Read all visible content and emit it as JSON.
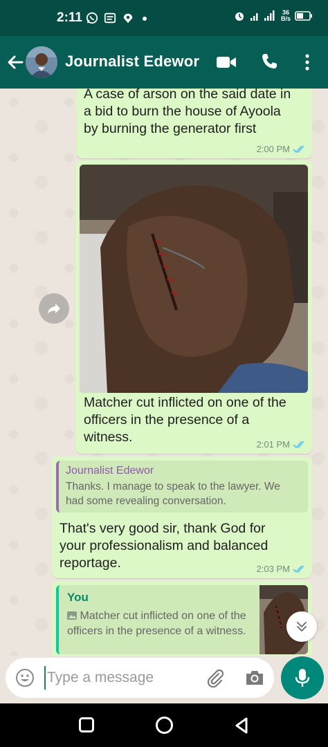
{
  "status_bar": {
    "time": "2:11",
    "network_speed_value": "36",
    "network_speed_unit": "B/s",
    "network_type": "3G"
  },
  "header": {
    "contact_name": "Journalist Edewor"
  },
  "messages": [
    {
      "text": "A case of arson on the said date in a bid to burn the house of Ayoola by burning the generator first",
      "time": "2:00 PM"
    },
    {
      "caption": "Matcher cut inflicted on one of the officers in the presence of a witness.",
      "time": "2:01 PM"
    },
    {
      "quoted_sender": "Journalist Edewor",
      "quoted_text": "Thanks. I manage to speak to the lawyer. We had some revealing conversation.",
      "text": "That's very good sir, thank God for your professionalism and balanced reportage.",
      "time": "2:03 PM"
    },
    {
      "quoted_sender": "You",
      "quoted_text": "Matcher cut inflicted on one of the officers in the presence of a witness."
    }
  ],
  "input": {
    "placeholder": "Type a message"
  },
  "colors": {
    "status_bar": "#054d44",
    "app_bar": "#075e54",
    "outgoing_bubble": "#dcf8c6",
    "read_ticks": "#4fc3f7",
    "mic_button": "#00897b"
  }
}
